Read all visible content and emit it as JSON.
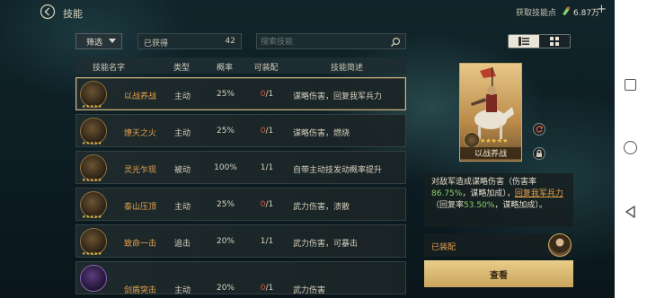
{
  "header": {
    "title": "技能",
    "gain_label": "获取技能点",
    "gain_value": "6.87万",
    "plus": "+"
  },
  "filter": {
    "filter_label": "筛选",
    "owned_label": "已获得",
    "owned_count": "42",
    "search_placeholder": "搜索技能"
  },
  "table": {
    "headers": {
      "name": "技能名字",
      "type": "类型",
      "rate": "概率",
      "equip": "可装配",
      "desc": "技能简述"
    },
    "rows": [
      {
        "name": "以战养战",
        "type": "主动",
        "rate": "25%",
        "equip_used": "0",
        "equip_total": "/1",
        "desc": "谋略伤害，回复我军兵力",
        "stars": "★★★★★"
      },
      {
        "name": "燎天之火",
        "type": "主动",
        "rate": "25%",
        "equip_used": "0",
        "equip_total": "/1",
        "desc": "谋略伤害，燃烧",
        "stars": "★★★★★"
      },
      {
        "name": "灵光乍现",
        "type": "被动",
        "rate": "100%",
        "equip_used": "1",
        "equip_total": "/1",
        "desc": "自带主动技发动概率提升",
        "stars": "★★★★★"
      },
      {
        "name": "泰山压顶",
        "type": "主动",
        "rate": "25%",
        "equip_used": "0",
        "equip_total": "/1",
        "desc": "武力伤害，溃散",
        "stars": "★★★★★"
      },
      {
        "name": "致命一击",
        "type": "追击",
        "rate": "20%",
        "equip_used": "1",
        "equip_total": "/1",
        "desc": "武力伤害，可暴击",
        "stars": "★★★★★"
      },
      {
        "name": "剑盾突击",
        "type": "主动",
        "rate": "20%",
        "equip_used": "0",
        "equip_total": "/1",
        "desc": "武力伤害",
        "stars": "★★★★★"
      }
    ]
  },
  "detail": {
    "card_name": "以战养战",
    "card_stars": "★★★★★",
    "desc_part1": "对敌军造成谋略伤害（伤害率",
    "desc_rate1": "86.75%",
    "desc_part2": "，谋略加成），",
    "desc_link": "回复我军兵力",
    "desc_part3": "（回复率",
    "desc_rate2": "53.50%",
    "desc_part4": "，谋略加成）。",
    "equipped_label": "已装配",
    "view_button": "查看"
  },
  "colors": {
    "accent_orange": "#e7a34c",
    "green_value": "#8dcf6c",
    "zero_red": "#d6583c",
    "gold_button": "#d9b86f"
  }
}
